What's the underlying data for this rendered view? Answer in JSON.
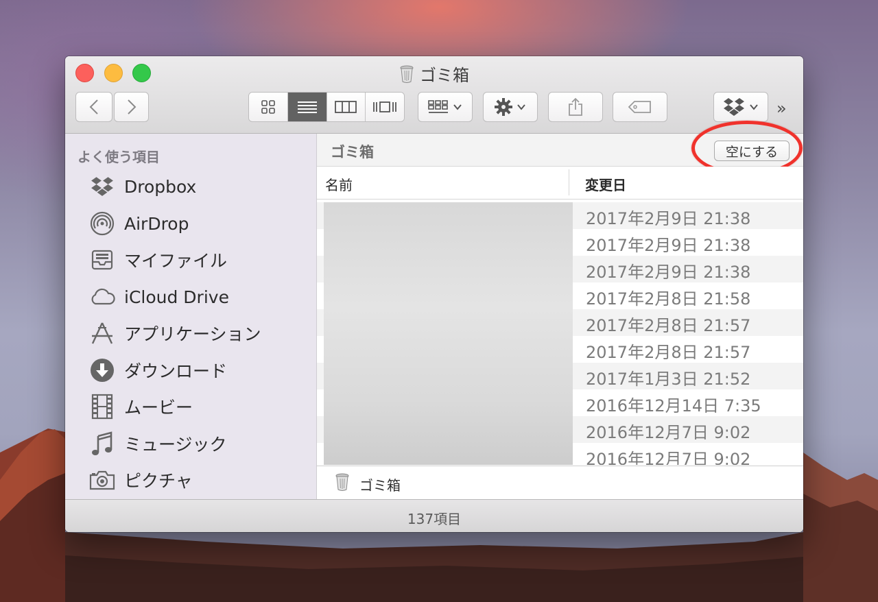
{
  "window": {
    "title": "ゴミ箱",
    "status": "137項目"
  },
  "toolbar": {
    "back_icon": "chevron-left-icon",
    "forward_icon": "chevron-right-icon",
    "view_modes": [
      "icon-view",
      "list-view",
      "column-view",
      "cover-flow-view"
    ],
    "active_view": "list-view",
    "overflow": "»"
  },
  "sidebar": {
    "heading": "よく使う項目",
    "items": [
      {
        "label": "Dropbox",
        "icon": "dropbox-icon"
      },
      {
        "label": "AirDrop",
        "icon": "airdrop-icon"
      },
      {
        "label": "マイファイル",
        "icon": "all-my-files-icon"
      },
      {
        "label": "iCloud Drive",
        "icon": "cloud-icon"
      },
      {
        "label": "アプリケーション",
        "icon": "applications-icon"
      },
      {
        "label": "ダウンロード",
        "icon": "download-icon"
      },
      {
        "label": "ムービー",
        "icon": "film-icon"
      },
      {
        "label": "ミュージック",
        "icon": "music-note-icon"
      },
      {
        "label": "ピクチャ",
        "icon": "camera-icon"
      }
    ]
  },
  "main": {
    "path_title": "ゴミ箱",
    "empty_button": "空にする",
    "columns": {
      "name": "名前",
      "modified": "変更日"
    },
    "rows": [
      {
        "date": "2017年2月9日 21:38"
      },
      {
        "date": "2017年2月9日 21:38"
      },
      {
        "date": "2017年2月9日 21:38"
      },
      {
        "date": "2017年2月8日 21:58"
      },
      {
        "date": "2017年2月8日 21:57"
      },
      {
        "date": "2017年2月8日 21:57"
      },
      {
        "date": "2017年1月3日 21:52"
      },
      {
        "date": "2016年12月14日 7:35"
      },
      {
        "date": "2016年12月7日 9:02"
      },
      {
        "date": "2016年12月7日 9:02"
      }
    ],
    "footer_path": "ゴミ箱"
  },
  "colors": {
    "accent_ring": "#f0322c",
    "close": "#fc605c",
    "minimize": "#fdbc40",
    "zoom": "#34c84a"
  }
}
